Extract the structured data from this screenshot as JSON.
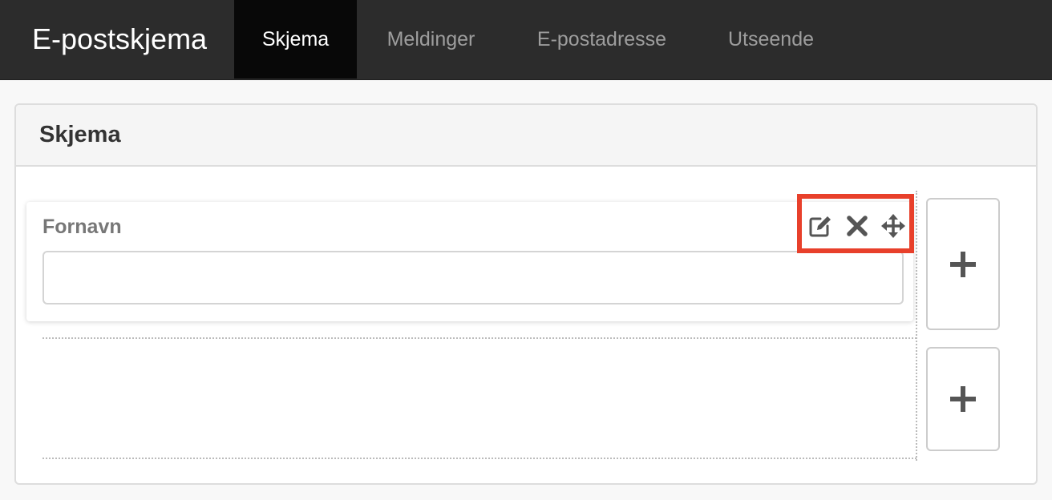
{
  "navbar": {
    "brand": "E-postskjema",
    "tabs": [
      {
        "label": "Skjema",
        "active": true
      },
      {
        "label": "Meldinger",
        "active": false
      },
      {
        "label": "E-postadresse",
        "active": false
      },
      {
        "label": "Utseende",
        "active": false
      }
    ]
  },
  "panel": {
    "title": "Skjema",
    "field": {
      "label": "Fornavn",
      "value": "",
      "placeholder": "",
      "tools": [
        "edit-icon",
        "close-icon",
        "move-icon"
      ]
    },
    "add_buttons": [
      "plus-icon",
      "plus-icon"
    ]
  },
  "colors": {
    "navbar_bg": "#2c2c2c",
    "active_tab_bg": "#080808",
    "highlight_border": "#e8402b",
    "icon_color": "#555555"
  }
}
